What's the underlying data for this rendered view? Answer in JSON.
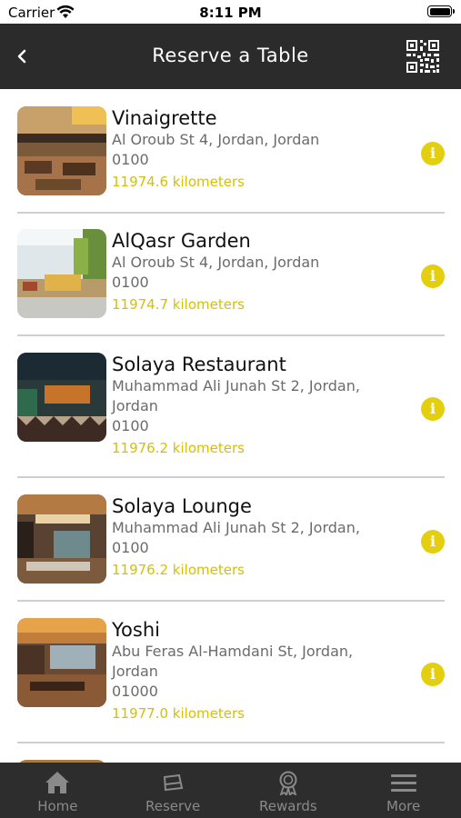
{
  "status_bar": {
    "carrier": "Carrier",
    "time": "8:11 PM"
  },
  "nav": {
    "title": "Reserve a Table",
    "back_icon": "chevron-left-icon",
    "action_icon": "qr-code-icon"
  },
  "restaurants": [
    {
      "name": "Vinaigrette",
      "address": [
        "Al Oroub St 4, Jordan, Jordan",
        "0100"
      ],
      "distance": "11974.6 kilometers"
    },
    {
      "name": "AlQasr Garden",
      "address": [
        "Al Oroub St 4, Jordan, Jordan",
        "0100"
      ],
      "distance": "11974.7 kilometers"
    },
    {
      "name": "Solaya Restaurant",
      "address": [
        "Muhammad Ali Junah St 2, Jordan,",
        "Jordan",
        "0100"
      ],
      "distance": "11976.2 kilometers"
    },
    {
      "name": "Solaya Lounge",
      "address": [
        "Muhammad Ali Junah St 2, Jordan,",
        "0100"
      ],
      "distance": "11976.2 kilometers"
    },
    {
      "name": "Yoshi",
      "address": [
        "Abu Feras Al-Hamdani St, Jordan,",
        "Jordan",
        "01000"
      ],
      "distance": "11977.0 kilometers"
    }
  ],
  "tabs": [
    {
      "label": "Home",
      "icon": "home-icon"
    },
    {
      "label": "Reserve",
      "icon": "reserve-icon"
    },
    {
      "label": "Rewards",
      "icon": "rewards-icon"
    },
    {
      "label": "More",
      "icon": "menu-icon"
    }
  ],
  "colors": {
    "nav_bg": "#2b2b2b",
    "accent": "#e3cf10",
    "distance_text": "#d4c008",
    "tab_bar_bg": "#2d2d2d"
  }
}
